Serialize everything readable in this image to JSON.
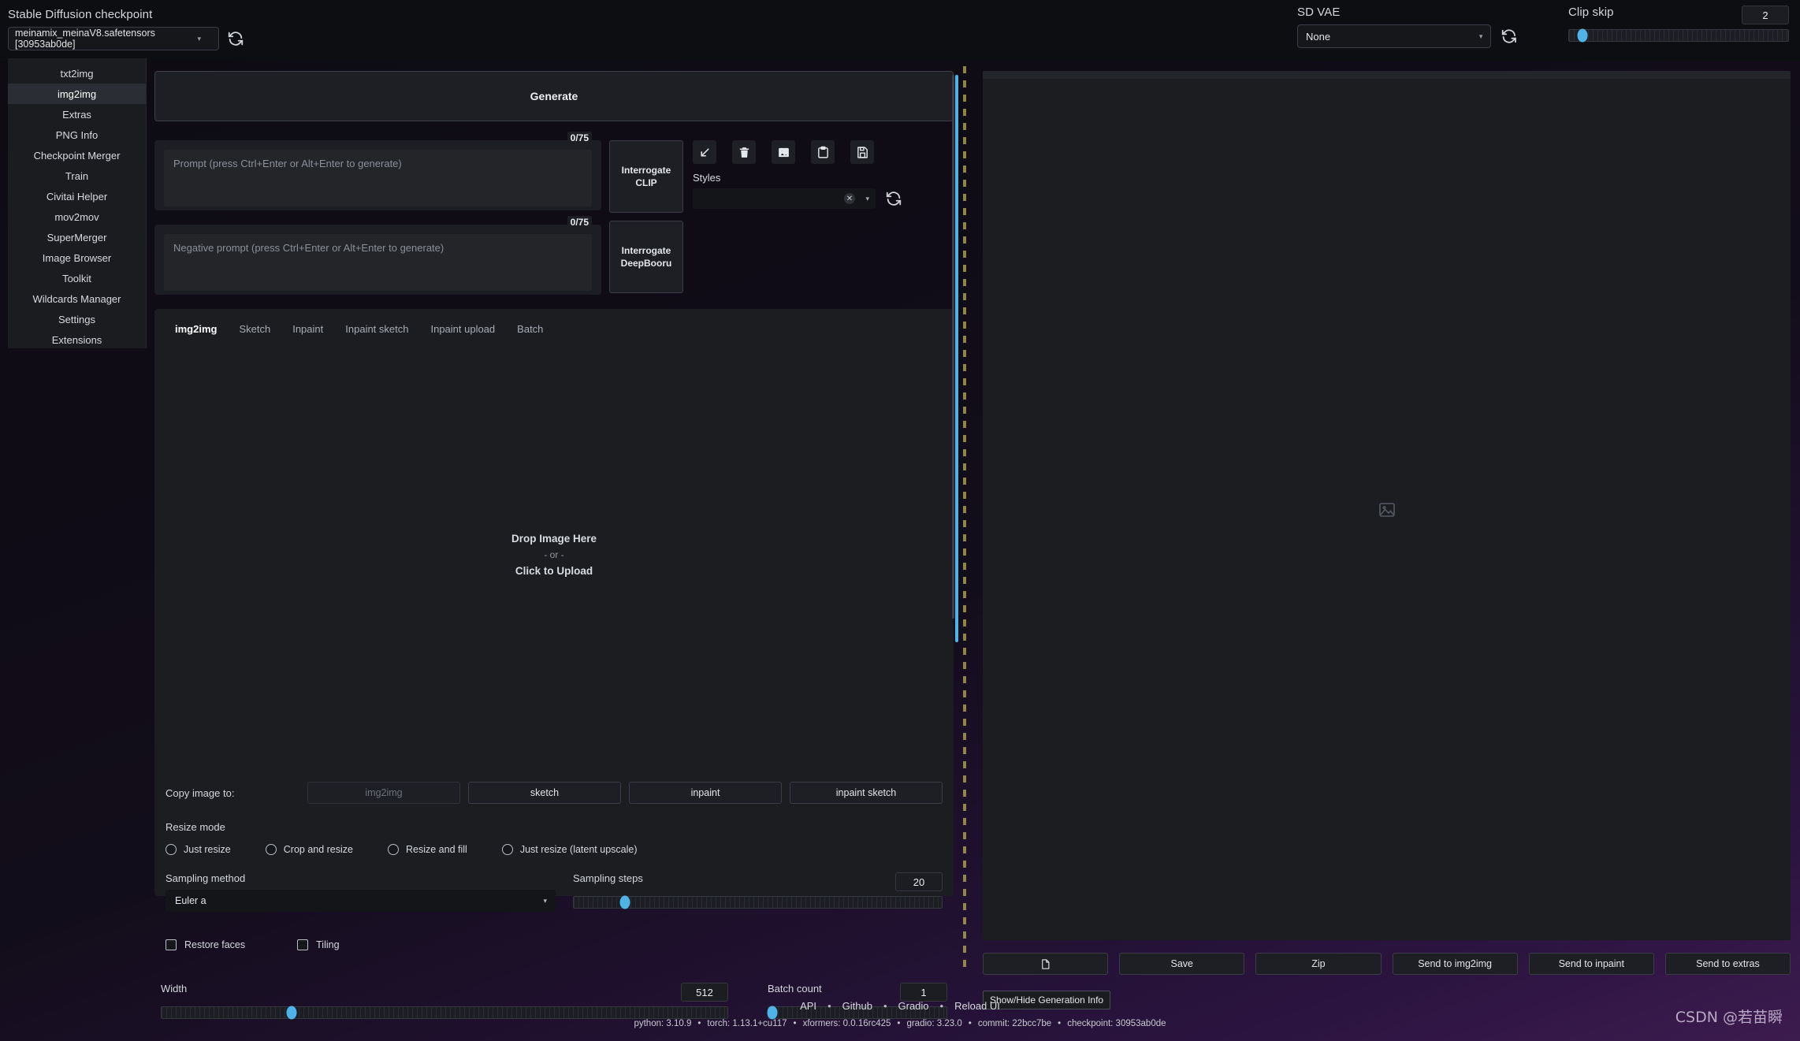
{
  "topbar": {
    "checkpoint_label": "Stable Diffusion checkpoint",
    "checkpoint_value": "meinamix_meinaV8.safetensors [30953ab0de]",
    "checkpoint_refresh_icon": "refresh-icon",
    "vae_label": "SD VAE",
    "vae_value": "None",
    "vae_refresh_icon": "refresh-icon",
    "clip_skip_label": "Clip skip",
    "clip_skip_value": "2",
    "clip_skip_percent": 6
  },
  "sidebar": {
    "items": [
      {
        "label": "txt2img",
        "active": false
      },
      {
        "label": "img2img",
        "active": true
      },
      {
        "label": "Extras",
        "active": false
      },
      {
        "label": "PNG Info",
        "active": false
      },
      {
        "label": "Checkpoint Merger",
        "active": false
      },
      {
        "label": "Train",
        "active": false
      },
      {
        "label": "Civitai Helper",
        "active": false
      },
      {
        "label": "mov2mov",
        "active": false
      },
      {
        "label": "SuperMerger",
        "active": false
      },
      {
        "label": "Image Browser",
        "active": false
      },
      {
        "label": "Toolkit",
        "active": false
      },
      {
        "label": "Wildcards Manager",
        "active": false
      },
      {
        "label": "Settings",
        "active": false
      },
      {
        "label": "Extensions",
        "active": false
      }
    ]
  },
  "main": {
    "generate_label": "Generate",
    "prompt": {
      "value": "",
      "placeholder": "Prompt (press Ctrl+Enter or Alt+Enter to generate)",
      "counter": "0/75"
    },
    "negative_prompt": {
      "value": "",
      "placeholder": "Negative prompt (press Ctrl+Enter or Alt+Enter to generate)",
      "counter": "0/75"
    },
    "interrogate_clip": "Interrogate CLIP",
    "interrogate_deepbooru": "Interrogate DeepBooru",
    "tools": [
      {
        "name": "restore-progress-icon",
        "glyph": "arrow-down-left"
      },
      {
        "name": "clear-prompt-icon",
        "glyph": "trash"
      },
      {
        "name": "show-extra-networks-icon",
        "glyph": "image"
      },
      {
        "name": "paste-icon",
        "glyph": "clipboard"
      },
      {
        "name": "save-style-icon",
        "glyph": "floppy"
      }
    ],
    "styles_label": "Styles",
    "styles_value": "",
    "styles_refresh_icon": "refresh-icon",
    "tabs": [
      {
        "label": "img2img",
        "active": true
      },
      {
        "label": "Sketch",
        "active": false
      },
      {
        "label": "Inpaint",
        "active": false
      },
      {
        "label": "Inpaint sketch",
        "active": false
      },
      {
        "label": "Inpaint upload",
        "active": false
      },
      {
        "label": "Batch",
        "active": false
      }
    ],
    "dropzone": {
      "main": "Drop Image Here",
      "or": "- or -",
      "click": "Click to Upload"
    },
    "copy_image_to": {
      "label": "Copy image to:",
      "buttons": [
        {
          "label": "img2img",
          "disabled": true
        },
        {
          "label": "sketch",
          "disabled": false
        },
        {
          "label": "inpaint",
          "disabled": false
        },
        {
          "label": "inpaint sketch",
          "disabled": false
        }
      ]
    },
    "resize_mode": {
      "label": "Resize mode",
      "options": [
        {
          "label": "Just resize",
          "selected": false
        },
        {
          "label": "Crop and resize",
          "selected": false
        },
        {
          "label": "Resize and fill",
          "selected": false
        },
        {
          "label": "Just resize (latent upscale)",
          "selected": false
        }
      ]
    },
    "sampling_method": {
      "label": "Sampling method",
      "value": "Euler a"
    },
    "sampling_steps": {
      "label": "Sampling steps",
      "value": "20",
      "percent": 14
    },
    "restore_faces": {
      "label": "Restore faces",
      "checked": false
    },
    "tiling": {
      "label": "Tiling",
      "checked": false
    },
    "width": {
      "label": "Width",
      "value": "512",
      "percent": 23
    },
    "batch_count": {
      "label": "Batch count",
      "value": "1",
      "percent": 2
    }
  },
  "right": {
    "gallery_placeholder_icon": "image-placeholder-icon",
    "buttons": [
      {
        "label": "",
        "icon": "folder-icon"
      },
      {
        "label": "Save",
        "icon": ""
      },
      {
        "label": "Zip",
        "icon": ""
      },
      {
        "label": "Send to img2img",
        "icon": ""
      },
      {
        "label": "Send to inpaint",
        "icon": ""
      },
      {
        "label": "Send to extras",
        "icon": ""
      }
    ],
    "show_hide_generation_info": "Show/Hide Generation Info"
  },
  "footer": {
    "links": [
      "API",
      "Github",
      "Gradio",
      "Reload UI"
    ],
    "separator": "•",
    "versions": [
      "python: 3.10.9",
      "torch: 1.13.1+cu117",
      "xformers: 0.0.16rc425",
      "gradio: 3.23.0",
      "commit: 22bcc7be",
      "checkpoint: 30953ab0de"
    ],
    "watermark": "CSDN @若苗瞬"
  }
}
